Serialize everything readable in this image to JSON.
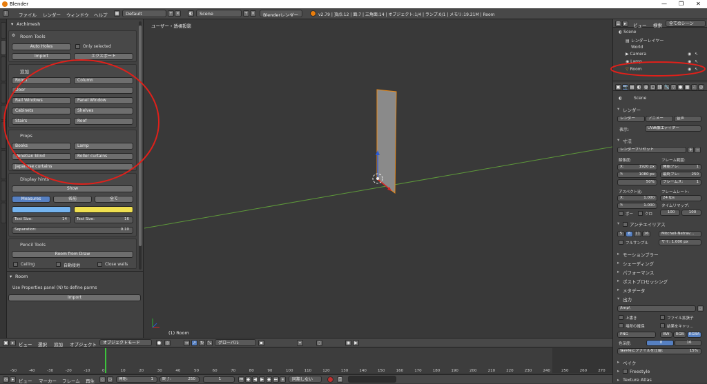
{
  "window": {
    "title": "Blender",
    "controls": [
      "—",
      "❐",
      "✕"
    ]
  },
  "menubar": {
    "menus": [
      "ファイル",
      "レンダー",
      "ウィンドウ",
      "ヘルプ"
    ],
    "screen_layout": "Default",
    "scene": "Scene",
    "engine": "Blenderレンダー",
    "stats": "v2.79 | 頂点:12 | 面:7 | 三角面:14 | オブジェクト:1/4 | ランプ:0/1 | メモリ:19.21M | Room"
  },
  "toolshelf": {
    "header": "Archimesh",
    "room_tools": {
      "title": "Room Tools",
      "auto_holes": "Auto Holes",
      "only_selected": "Only selected",
      "import": "Import",
      "export": "エクスポート"
    },
    "add_section": {
      "title": "追加",
      "buttons": [
        "Room",
        "Column",
        "Door",
        "Rail Windows",
        "Panel Window",
        "Cabinets",
        "Shelves",
        "Stairs",
        "Roof"
      ]
    },
    "props": {
      "title": "Props",
      "buttons": [
        "Books",
        "Lamp",
        "Venetian blind",
        "Roller curtains",
        "Japanese curtains"
      ]
    },
    "display_hints": {
      "title": "Display hints",
      "show": "Show",
      "measures": "Measures",
      "name": "名前",
      "all": "全て",
      "text_size_left": "Text Size:",
      "text_size_left_val": "14",
      "text_size_right": "Text Size:",
      "text_size_right_val": "16",
      "separation": "Separation:",
      "separation_val": "0.10",
      "color_left": "#74b4f0",
      "color_right": "#f0e050"
    },
    "pencil_tools": {
      "title": "Pencil Tools",
      "room_from_draw": "Room from Draw",
      "ceiling": "Ceiling",
      "auto_link": "自動接地",
      "close_walls": "Close walls"
    }
  },
  "operator_panel": {
    "title": "Room",
    "hint": "Use Properties panel (N) to define parms",
    "import": "Import"
  },
  "viewport": {
    "label": "ユーザー・透視投影",
    "object_label": "(1) Room"
  },
  "view3d_header": {
    "view": "ビュー",
    "select": "選択",
    "add": "追加",
    "object": "オブジェクト",
    "mode": "オブジェクトモード",
    "orientation": "グローバル"
  },
  "timeline": {
    "menus": [
      "ビュー",
      "マーカー",
      "フレーム",
      "再生"
    ],
    "start_label": "開始:",
    "start": "1",
    "end_label": "終了:",
    "end": "250",
    "current": "1",
    "sync": "同期しない",
    "ticks": [
      "-50",
      "-40",
      "-30",
      "-20",
      "-10",
      "0",
      "10",
      "20",
      "30",
      "40",
      "50",
      "60",
      "70",
      "80",
      "90",
      "100",
      "110",
      "120",
      "130",
      "140",
      "150",
      "160",
      "170",
      "180",
      "190",
      "200",
      "210",
      "220",
      "230",
      "240",
      "250",
      "260",
      "270",
      "280"
    ]
  },
  "outliner": {
    "menus": [
      "ビュー",
      "検索"
    ],
    "filter": "全てのシーン",
    "items": [
      "Scene",
      "レンダーレイヤー",
      "World",
      "Camera",
      "Lamp",
      "Room"
    ]
  },
  "properties": {
    "context": "Scene",
    "render_title": "レンダー",
    "render_buttons": [
      "レンダー",
      "アニメー",
      "音声"
    ],
    "display_label": "表示:",
    "display_value": "UV画像エディター",
    "dimensions_title": "寸法",
    "render_preset": "レンダープリセット",
    "resolution_label": "解像度:",
    "res_x": "X:",
    "res_x_val": "1920 px",
    "res_y": "Y:",
    "res_y_val": "1080 px",
    "res_pct": "50%",
    "frame_range_label": "フレーム範囲:",
    "start_frame": "開始フレ:",
    "start_frame_val": "1",
    "end_frame": "最終フレ:",
    "end_frame_val": "250",
    "frame_step": "フレームス:",
    "frame_step_val": "1",
    "aspect_label": "アスペクト比:",
    "asp_x": "X:",
    "asp_x_val": "1.000",
    "asp_y": "Y:",
    "asp_y_val": "1.000",
    "frame_rate_label": "フレームレート:",
    "fps": "24 fps",
    "time_remap_label": "タイムリマップ:",
    "border": "ボー",
    "crop": "クロ",
    "remap_old": "100",
    "remap_new": "100",
    "aa_title": "アンチエイリアス",
    "aa_samples": [
      "5",
      "8",
      "11",
      "16"
    ],
    "aa_filter": "Mitchell-Netrav…",
    "full_sample": "フルサンプル",
    "aa_size": "サイ: 1.000 px",
    "sections": [
      "モーションブラー",
      "シェーディング",
      "パフォーマンス",
      "ポストプロセッシング",
      "メタデータ"
    ],
    "output_title": "出力",
    "output_path": "/tmp\\",
    "overwrite": "上書き",
    "file_ext": "ファイル拡張子",
    "placeholders": "場所の確保",
    "cache_result": "結果をキャッ…",
    "format": "PNG",
    "bw": "BW",
    "rgb": "RGB",
    "rgba": "RGBA",
    "color_depth_label": "色深度:",
    "depth_8": "8",
    "depth_16": "16",
    "compression_label": "保存時にファイルを圧縮:",
    "compression": "15%",
    "bake": "ベイク",
    "freestyle": "Freestyle",
    "texture_atlas": "Texture Atlas"
  },
  "annotations": {
    "circle_color": "#e0201a"
  }
}
